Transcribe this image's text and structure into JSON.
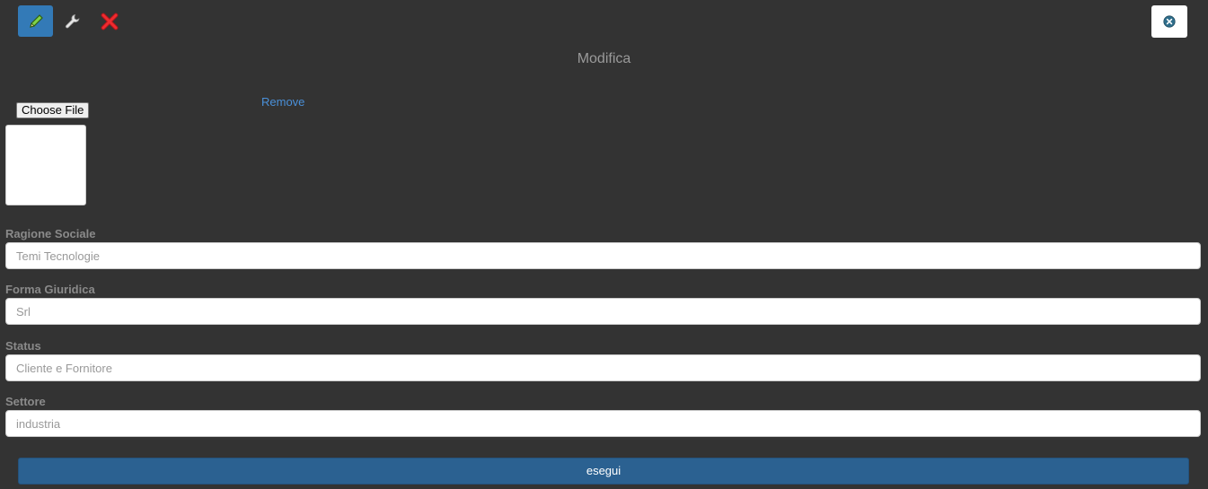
{
  "toolbar": {
    "icons": {
      "edit": "pencil-icon",
      "settings": "wrench-icon",
      "delete": "red-x-icon"
    },
    "close_icon": "close-circle-icon",
    "active_color": "#337ab7"
  },
  "page": {
    "title": "Modifica"
  },
  "upload": {
    "choose_label": "Choose File",
    "remove_label": "Remove"
  },
  "form": {
    "fields": [
      {
        "label": "Ragione Sociale",
        "value": "Temi Tecnologie"
      },
      {
        "label": "Forma Giuridica",
        "value": "Srl"
      },
      {
        "label": "Status",
        "value": "Cliente e Fornitore"
      },
      {
        "label": "Settore",
        "value": "industria"
      }
    ],
    "submit_label": "esegui",
    "submit_color": "#2b6191"
  }
}
